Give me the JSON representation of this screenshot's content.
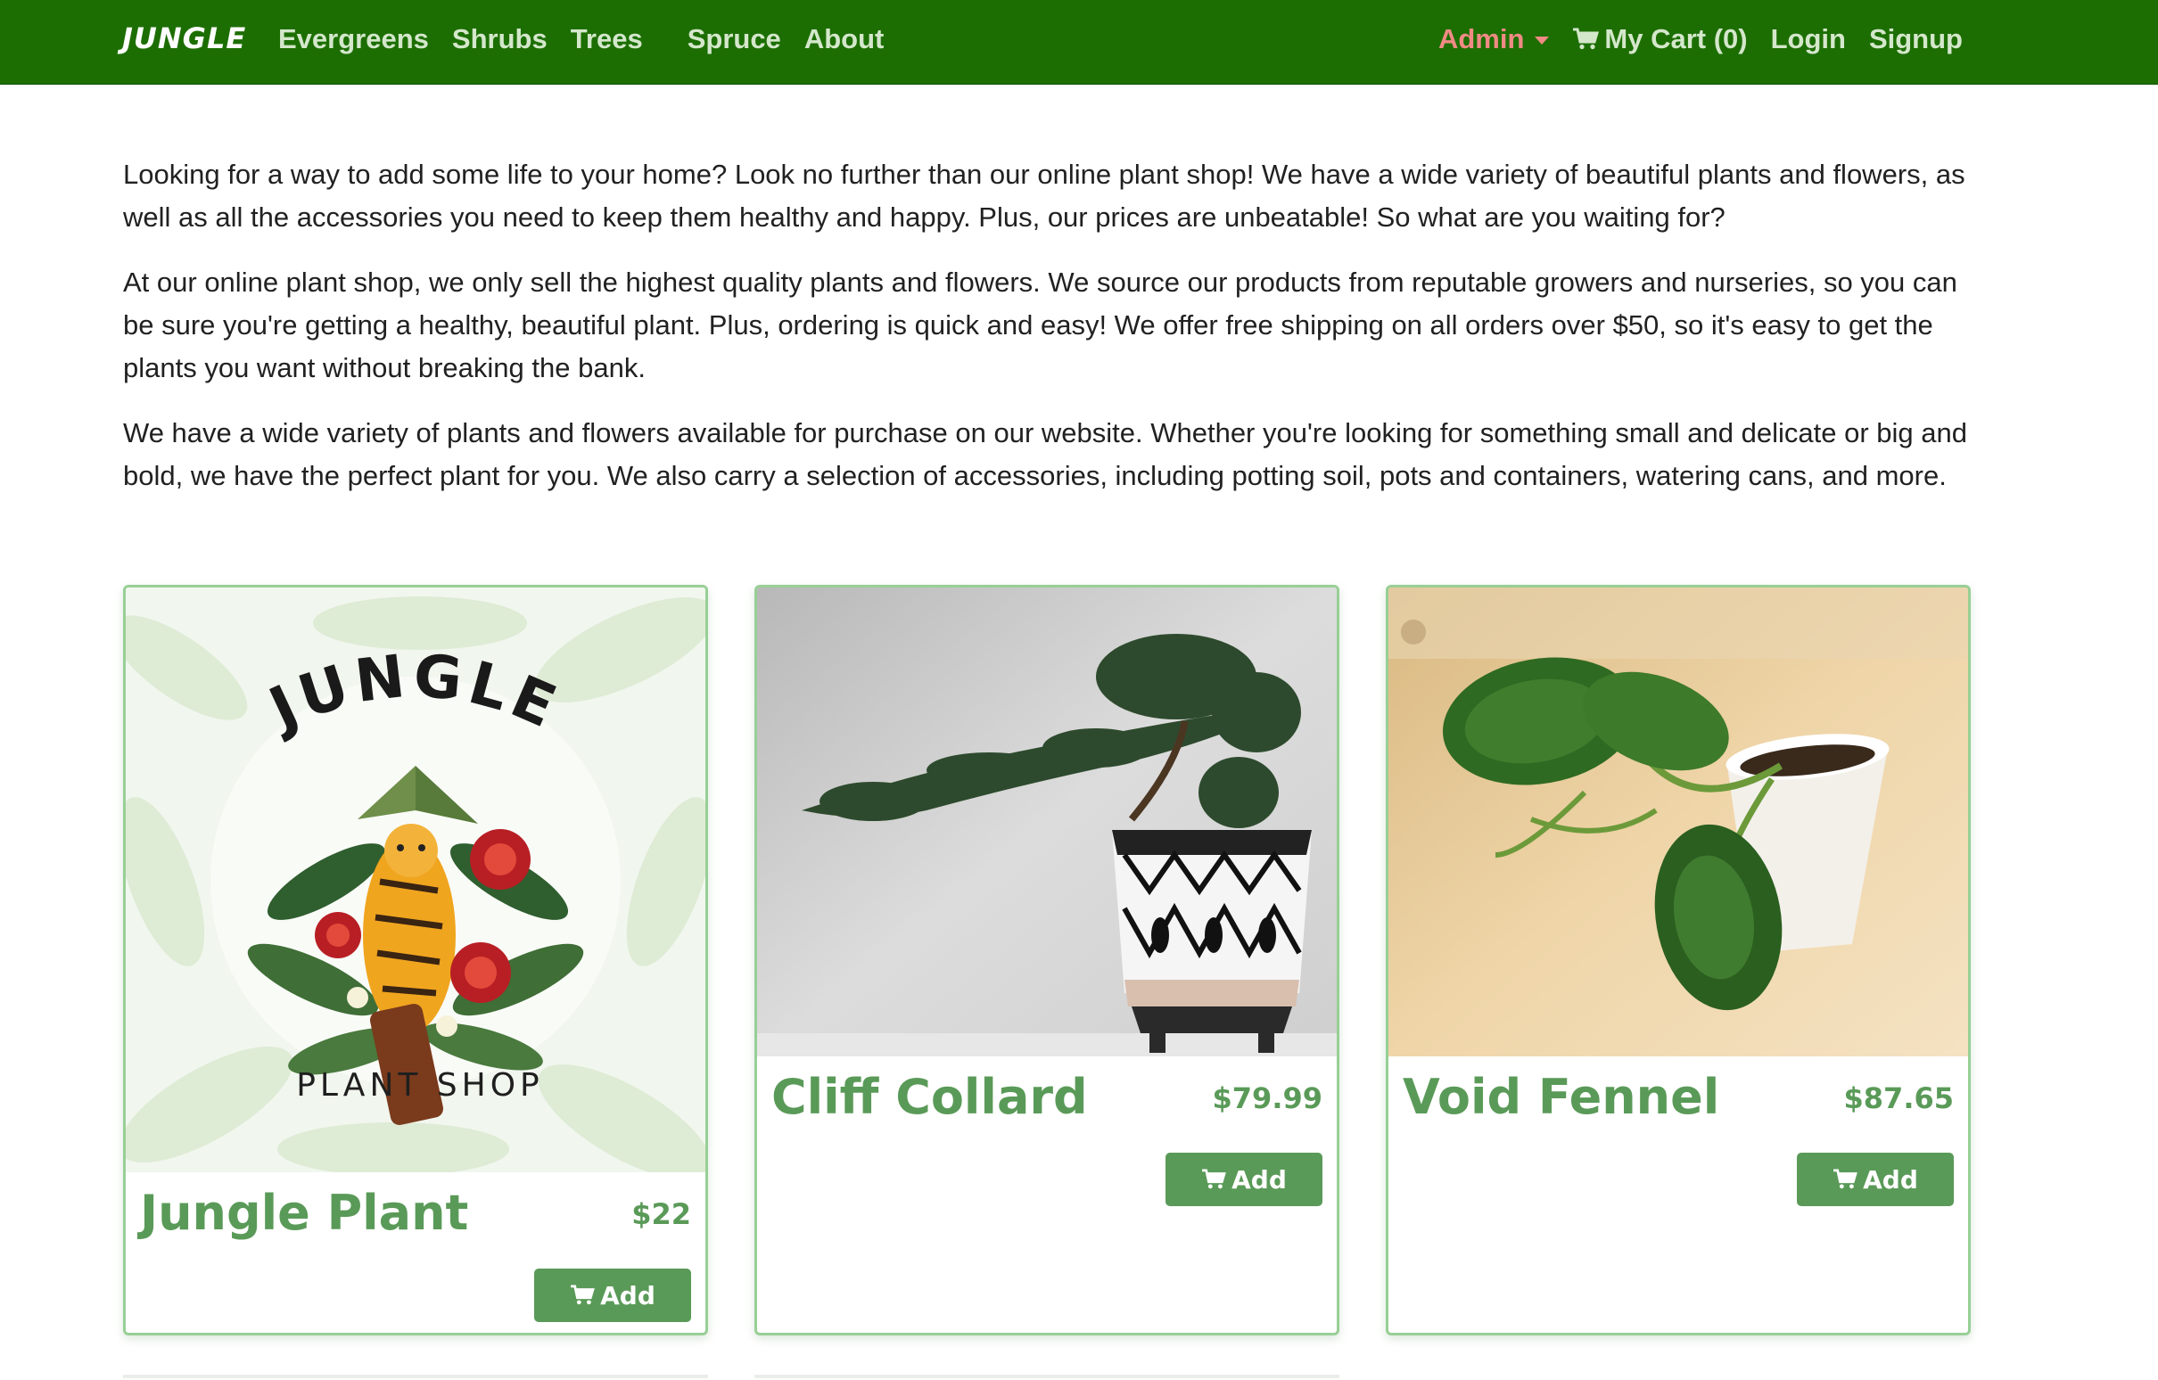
{
  "navbar": {
    "brand": "JUNGLE",
    "links": [
      "Evergreens",
      "Shrubs",
      "Trees",
      "Spruce",
      "About"
    ],
    "admin": "Admin",
    "cart": "My Cart (0)",
    "login": "Login",
    "signup": "Signup"
  },
  "intro": {
    "p1": "Looking for a way to add some life to your home? Look no further than our online plant shop! We have a wide variety of beautiful plants and flowers, as well as all the accessories you need to keep them healthy and happy. Plus, our prices are unbeatable! So what are you waiting for?",
    "p2": "At our online plant shop, we only sell the highest quality plants and flowers. We source our products from reputable growers and nurseries, so you can be sure you're getting a healthy, beautiful plant. Plus, ordering is quick and easy! We offer free shipping on all orders over $50, so it's easy to get the plants you want without breaking the bank.",
    "p3": "We have a wide variety of plants and flowers available for purchase on our website. Whether you're looking for something small and delicate or big and bold, we have the perfect plant for you. We also carry a selection of accessories, including potting soil, pots and containers, watering cans, and more."
  },
  "products": [
    {
      "name": "Jungle Plant",
      "price": "$22",
      "button": "Add",
      "logo_top": "JUNGLE",
      "logo_bottom": "PLANT SHOP"
    },
    {
      "name": "Cliff Collard",
      "price": "$79.99",
      "button": "Add"
    },
    {
      "name": "Void Fennel",
      "price": "$87.65",
      "button": "Add"
    }
  ],
  "colors": {
    "navbar_bg": "#1c6e02",
    "nav_link": "#d4e7cb",
    "admin": "#f08a84",
    "accent_green": "#5a9a58",
    "card_border": "#98cf96"
  },
  "icons": {
    "cart": "cart-icon",
    "caret": "caret-down-icon"
  }
}
